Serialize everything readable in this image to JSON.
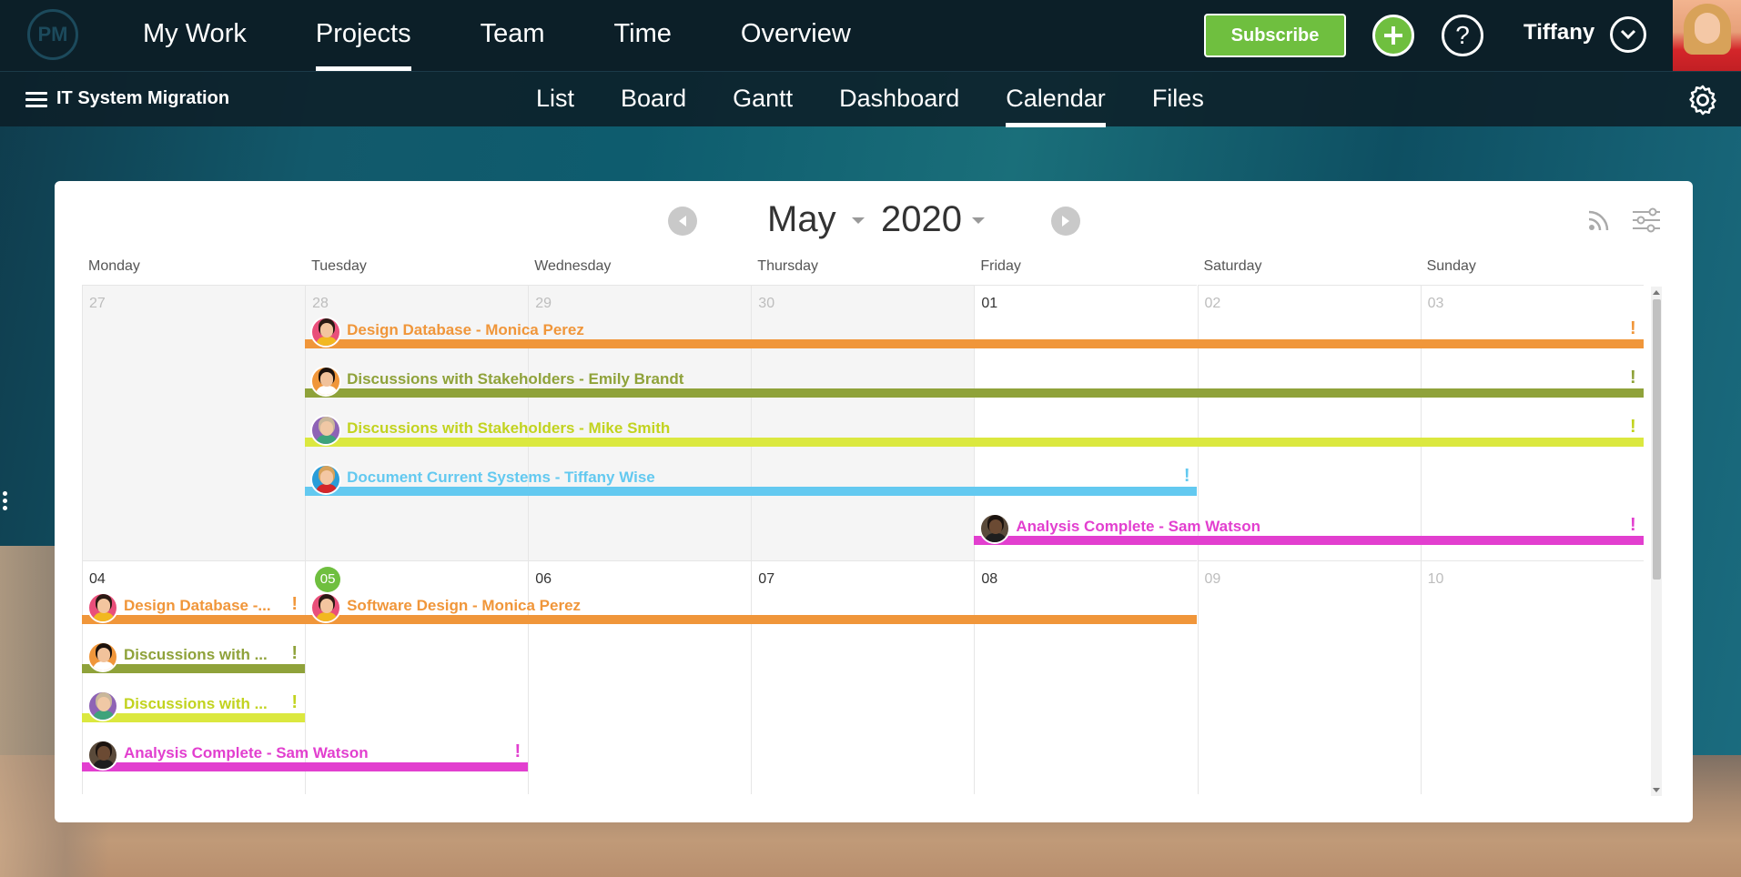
{
  "app": {
    "logo_text": "PM",
    "main_nav": [
      "My Work",
      "Projects",
      "Team",
      "Time",
      "Overview"
    ],
    "active_main": "Projects",
    "subscribe_label": "Subscribe",
    "user_name": "Tiffany",
    "icons": {
      "add": "plus-icon",
      "help": "question-icon",
      "user_menu": "chevron-down-icon",
      "menu": "hamburger-icon",
      "settings": "gear-icon",
      "prev": "chevron-left-icon",
      "next": "chevron-right-icon",
      "feed": "rss-icon",
      "filters": "sliders-icon"
    }
  },
  "project": {
    "name": "IT System Migration",
    "views": [
      "List",
      "Board",
      "Gantt",
      "Dashboard",
      "Calendar",
      "Files"
    ],
    "active_view": "Calendar"
  },
  "calendar": {
    "month": "May",
    "year": "2020",
    "weekdays": [
      "Monday",
      "Tuesday",
      "Wednesday",
      "Thursday",
      "Friday",
      "Saturday",
      "Sunday"
    ],
    "weeks": [
      {
        "days": [
          {
            "num": "27",
            "state": "out"
          },
          {
            "num": "28",
            "state": "out"
          },
          {
            "num": "29",
            "state": "out"
          },
          {
            "num": "30",
            "state": "out"
          },
          {
            "num": "01",
            "state": "normal"
          },
          {
            "num": "02",
            "state": "weekend"
          },
          {
            "num": "03",
            "state": "weekend"
          }
        ],
        "events": [
          {
            "label": "Design Database - Monica Perez",
            "start": 1,
            "span": 6,
            "row": 0,
            "color": "#f0963a",
            "person": "monica"
          },
          {
            "label": "Discussions with Stakeholders - Emily Brandt",
            "start": 1,
            "span": 6,
            "row": 1,
            "color": "#8fa23a",
            "person": "emily"
          },
          {
            "label": "Discussions with Stakeholders - Mike Smith",
            "start": 1,
            "span": 6,
            "row": 2,
            "color": "#dbe83f",
            "text_color": "#c2d31f",
            "person": "mike"
          },
          {
            "label": "Document Current Systems - Tiffany Wise",
            "start": 1,
            "span": 4,
            "row": 3,
            "color": "#63c9f0",
            "person": "tiffany"
          },
          {
            "label": "Analysis Complete - Sam Watson",
            "start": 4,
            "span": 3,
            "row": 4,
            "color": "#e23fcf",
            "person": "sam"
          }
        ]
      },
      {
        "days": [
          {
            "num": "04",
            "state": "normal"
          },
          {
            "num": "05",
            "state": "today"
          },
          {
            "num": "06",
            "state": "normal"
          },
          {
            "num": "07",
            "state": "normal"
          },
          {
            "num": "08",
            "state": "normal"
          },
          {
            "num": "09",
            "state": "weekend"
          },
          {
            "num": "10",
            "state": "weekend"
          }
        ],
        "events": [
          {
            "label": "Design Database -...",
            "start": 0,
            "span": 1,
            "row": 0,
            "color": "#f0963a",
            "person": "monica"
          },
          {
            "label": "Software Design - Monica Perez",
            "start": 1,
            "span": 4,
            "row": 0,
            "color": "#f0963a",
            "person": "monica",
            "no_excl": true
          },
          {
            "label": "Discussions with ...",
            "start": 0,
            "span": 1,
            "row": 1,
            "color": "#8fa23a",
            "person": "emily"
          },
          {
            "label": "Discussions with ...",
            "start": 0,
            "span": 1,
            "row": 2,
            "color": "#dbe83f",
            "text_color": "#c2d31f",
            "person": "mike"
          },
          {
            "label": "Analysis Complete - Sam Watson",
            "start": 0,
            "span": 2,
            "row": 3,
            "color": "#e23fcf",
            "person": "sam"
          }
        ]
      }
    ],
    "people": {
      "monica": {
        "bg": "#e94f7a",
        "skin": "#f3c59f",
        "hair": "#2b1a14",
        "shirt": "#f2b820"
      },
      "emily": {
        "bg": "#f0963a",
        "skin": "#f1c29b",
        "hair": "#1c120d",
        "shirt": "#ffffff"
      },
      "mike": {
        "bg": "#8e63b5",
        "skin": "#f0c8a5",
        "hair": "#c9b79a",
        "shirt": "#3ea37b"
      },
      "tiffany": {
        "bg": "#2a9dd8",
        "skin": "#f4c7a3",
        "hair": "#d7a25b",
        "shirt": "#d4262a"
      },
      "sam": {
        "bg": "#5a4a3a",
        "skin": "#6b4a33",
        "hair": "#1b130f",
        "shirt": "#1e1e1e"
      }
    },
    "mark": "!"
  }
}
